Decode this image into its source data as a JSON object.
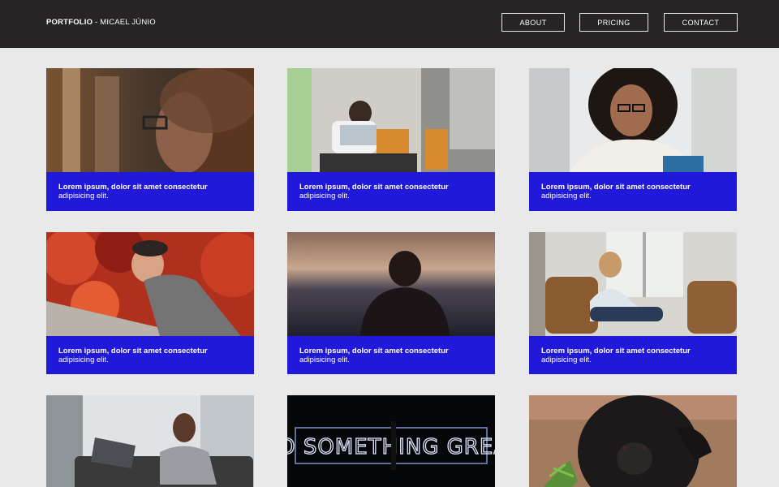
{
  "brand": {
    "name": "PORTFOLIO",
    "author": " - MICAEL JÚNIO"
  },
  "nav": {
    "about": "ABOUT",
    "pricing": "PRICING",
    "contact": "CONTACT"
  },
  "cards": [
    {
      "title": "Lorem ipsum, dolor sit amet consectetur",
      "subtitle": "adipisicing elit.",
      "image": "woman-glasses-profile-photo"
    },
    {
      "title": "Lorem ipsum, dolor sit amet consectetur",
      "subtitle": "adipisicing elit.",
      "image": "man-laptop-photo"
    },
    {
      "title": "Lorem ipsum, dolor sit amet consectetur",
      "subtitle": "adipisicing elit.",
      "image": "curly-hair-woman-photo"
    },
    {
      "title": "Lorem ipsum, dolor sit amet consectetur",
      "subtitle": "adipisicing elit.",
      "image": "woman-autumn-leaves-photo"
    },
    {
      "title": "Lorem ipsum, dolor sit amet consectetur",
      "subtitle": "adipisicing elit.",
      "image": "woman-silhouette-sunset-photo"
    },
    {
      "title": "Lorem ipsum, dolor sit amet consectetur",
      "subtitle": "adipisicing elit.",
      "image": "woman-armchair-photo"
    },
    {
      "title": "",
      "subtitle": "",
      "image": "woman-laptop-couch-photo"
    },
    {
      "title": "",
      "subtitle": "",
      "image": "neon-sign-photo",
      "sign_text": "DO SOMETHING GREAT"
    },
    {
      "title": "",
      "subtitle": "",
      "image": "gorilla-photo"
    }
  ],
  "colors": {
    "navbar": "#262425",
    "page": "#e9e9e9",
    "caption": "#2119d9",
    "text": "#ffffff"
  }
}
